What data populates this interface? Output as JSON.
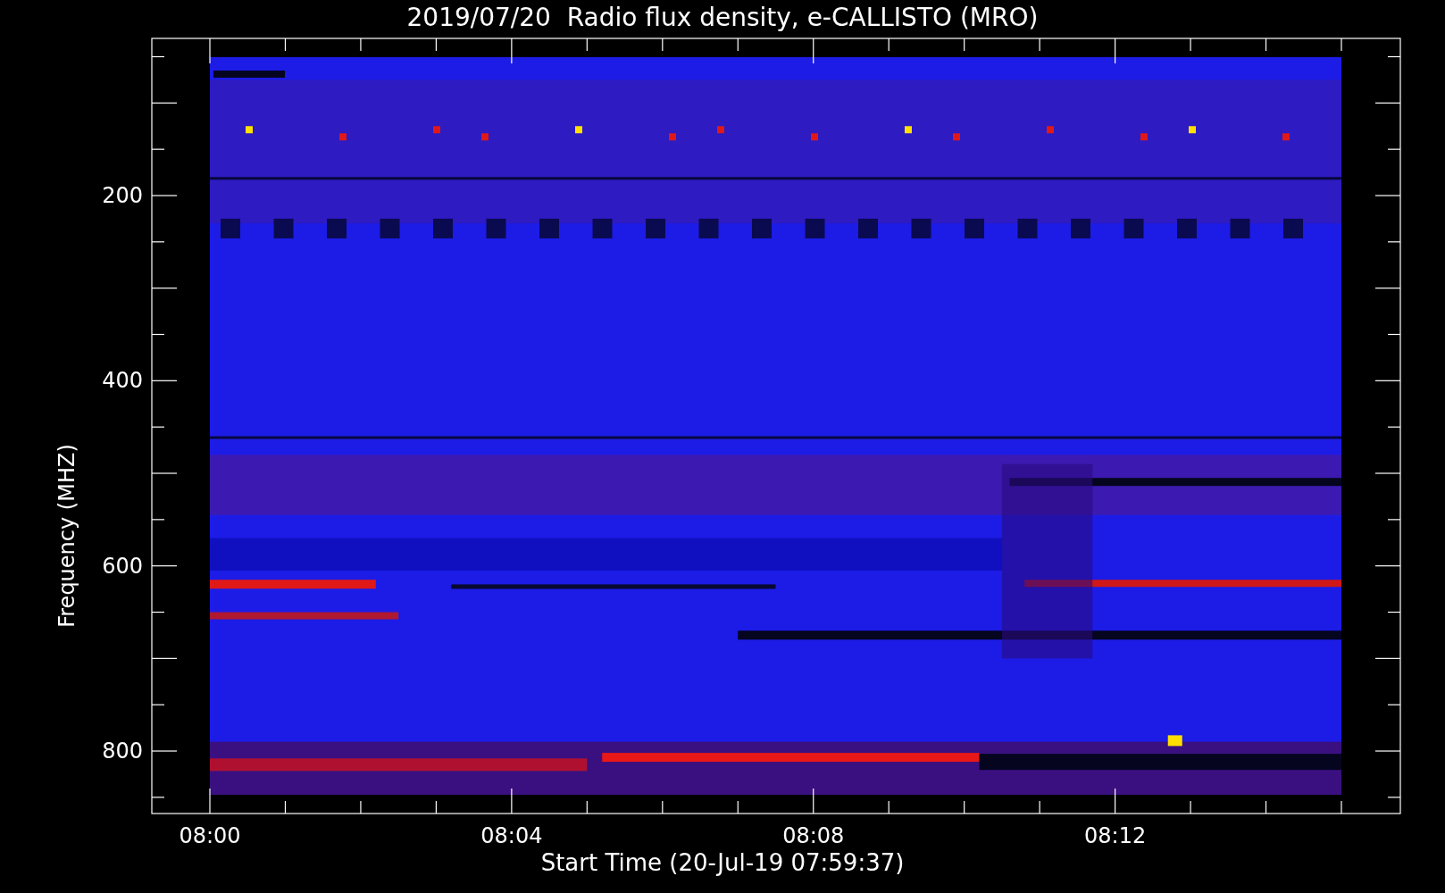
{
  "title": "2019/07/20  Radio flux density, e-CALLISTO (MRO)",
  "y_axis": {
    "label": "Frequency (MHZ)",
    "ticks": [
      "200",
      "400",
      "600",
      "800"
    ]
  },
  "x_axis": {
    "label": "Start Time (20-Jul-19 07:59:37)",
    "ticks": [
      "08:00",
      "08:04",
      "08:08",
      "08:12"
    ]
  }
}
